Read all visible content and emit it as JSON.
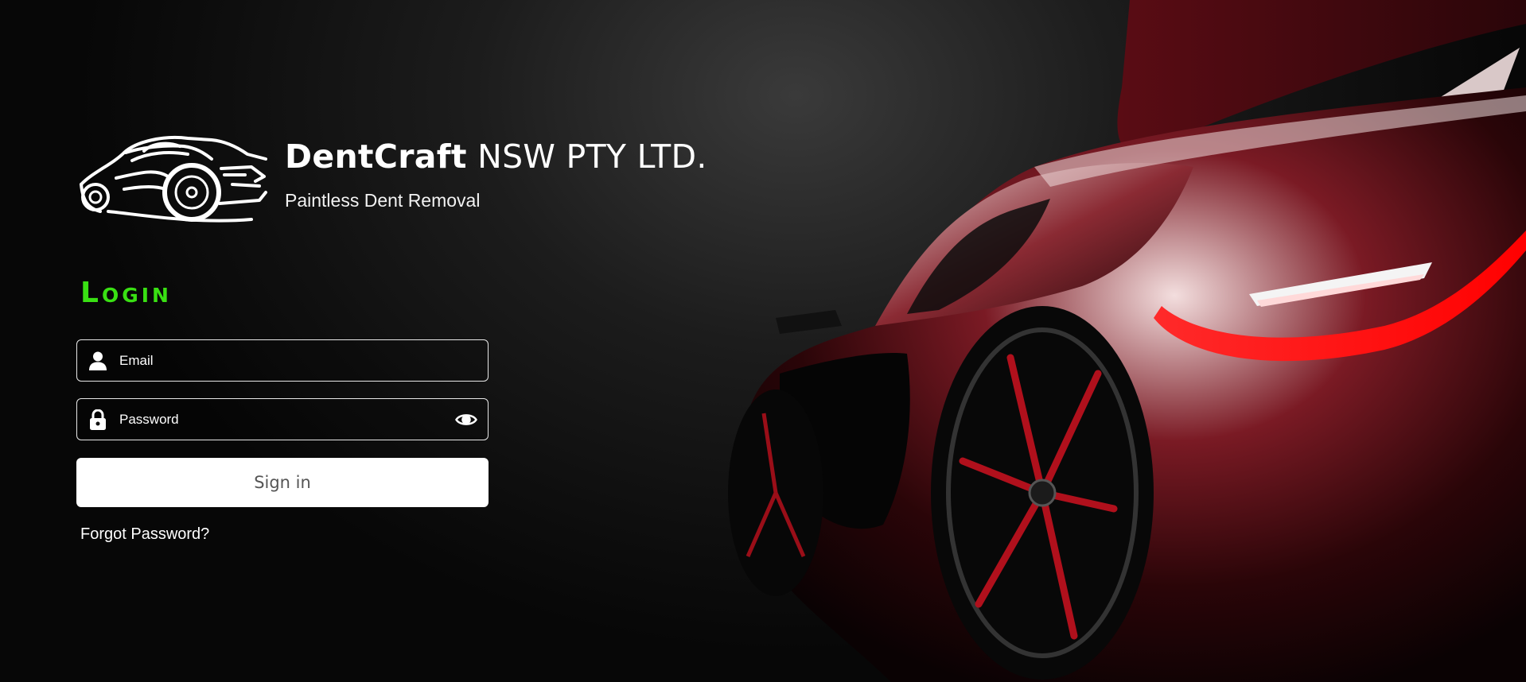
{
  "brand": {
    "name_bold": "DentCraft",
    "name_rest": "NSW PTY LTD.",
    "tagline": "Paintless Dent Removal",
    "logo_icon": "sports-car-outline-logo"
  },
  "login": {
    "title": "Login",
    "title_color": "#39e013",
    "email": {
      "placeholder": "Email",
      "value": "",
      "icon": "user-icon"
    },
    "password": {
      "placeholder": "Password",
      "value": "",
      "icon": "lock-icon",
      "toggle_icon": "eye-icon"
    },
    "submit_label": "Sign in",
    "forgot_label": "Forgot Password?"
  },
  "hero": {
    "image": "red-sports-car-rear-view",
    "accent": "#ff1a1a"
  }
}
